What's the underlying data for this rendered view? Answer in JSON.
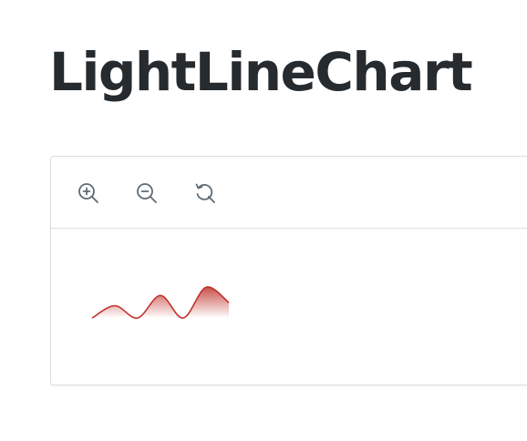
{
  "page": {
    "title": "LightLineChart"
  },
  "toolbar": {
    "zoom_in": {
      "icon": "zoom-in-icon"
    },
    "zoom_out": {
      "icon": "zoom-out-icon"
    },
    "reset": {
      "icon": "reset-icon"
    }
  },
  "colors": {
    "title": "#262b30",
    "line": "#c0302a",
    "fill": "#c0302a",
    "icon": "#5f6b75",
    "border": "#dcdfe2"
  },
  "chart_data": {
    "type": "area",
    "title": "",
    "xlabel": "",
    "ylabel": "",
    "grid": false,
    "x": [
      0,
      1,
      2,
      3,
      4,
      5,
      6
    ],
    "series": [
      {
        "values": [
          0,
          1.2,
          0,
          2.2,
          0,
          3.0,
          1.5
        ]
      }
    ],
    "ylim": [
      0,
      3.2
    ]
  }
}
